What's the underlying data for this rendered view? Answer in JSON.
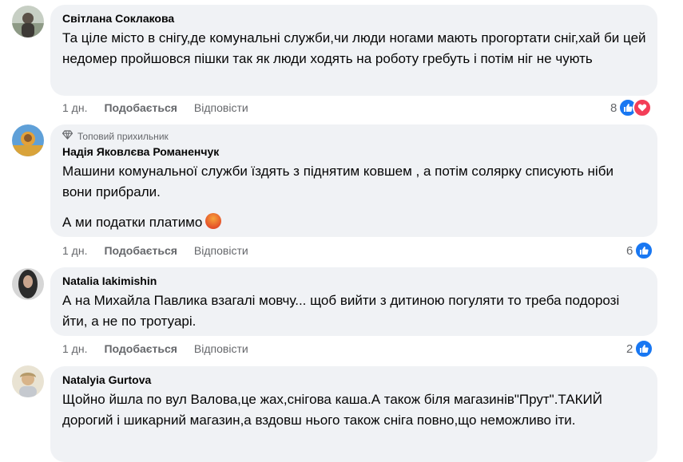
{
  "comments": [
    {
      "author": "Світлана Соклакова",
      "badge": "",
      "paragraphs": [
        "Та ціле місто в снігу,де комунальні служби,чи люди ногами мають прогортати сніг,хай би цей недомер пройшовся пішки так як люди ходять на роботу гребуть і потім ніг не чують"
      ],
      "time": "1 дн.",
      "like_label": "Подобається",
      "reply_label": "Відповісти",
      "reaction_count": "8",
      "reactions": [
        "like-icon",
        "love-icon"
      ]
    },
    {
      "author": "Надія Яковлєва Романенчук",
      "badge": "Топовий прихильник",
      "paragraphs": [
        "Машини комунальної служби їздять з піднятим ковшем , а потім солярку списують ніби вони прибрали.",
        "А ми податки платимо"
      ],
      "time": "1 дн.",
      "like_label": "Подобається",
      "reply_label": "Відповісти",
      "reaction_count": "6",
      "reactions": [
        "like-icon"
      ]
    },
    {
      "author": "Natalia Iakimishin",
      "badge": "",
      "paragraphs": [
        "А на Михайла Павлика взагалі мовчу... щоб вийти з дитиною погуляти то треба подорозі йти, а не по тротуарі."
      ],
      "time": "1 дн.",
      "like_label": "Подобається",
      "reply_label": "Відповісти",
      "reaction_count": "2",
      "reactions": [
        "like-icon"
      ]
    },
    {
      "author": "Natalyia Gurtova",
      "badge": "",
      "paragraphs": [
        "Щойно йшла по вул Валова,це жах,снігова каша.А також біля магазинів\"Прут\".ТАКИЙ дорогий і шикарний магазин,а вздовш нього також сніга повно,що неможливо іти."
      ],
      "time": "",
      "like_label": "",
      "reply_label": "",
      "reaction_count": "",
      "reactions": []
    }
  ],
  "colors": {
    "bubble": "#f0f2f5",
    "like_blue": "#1877f2",
    "love_red": "#f33e58",
    "meta_gray": "#65676b"
  }
}
